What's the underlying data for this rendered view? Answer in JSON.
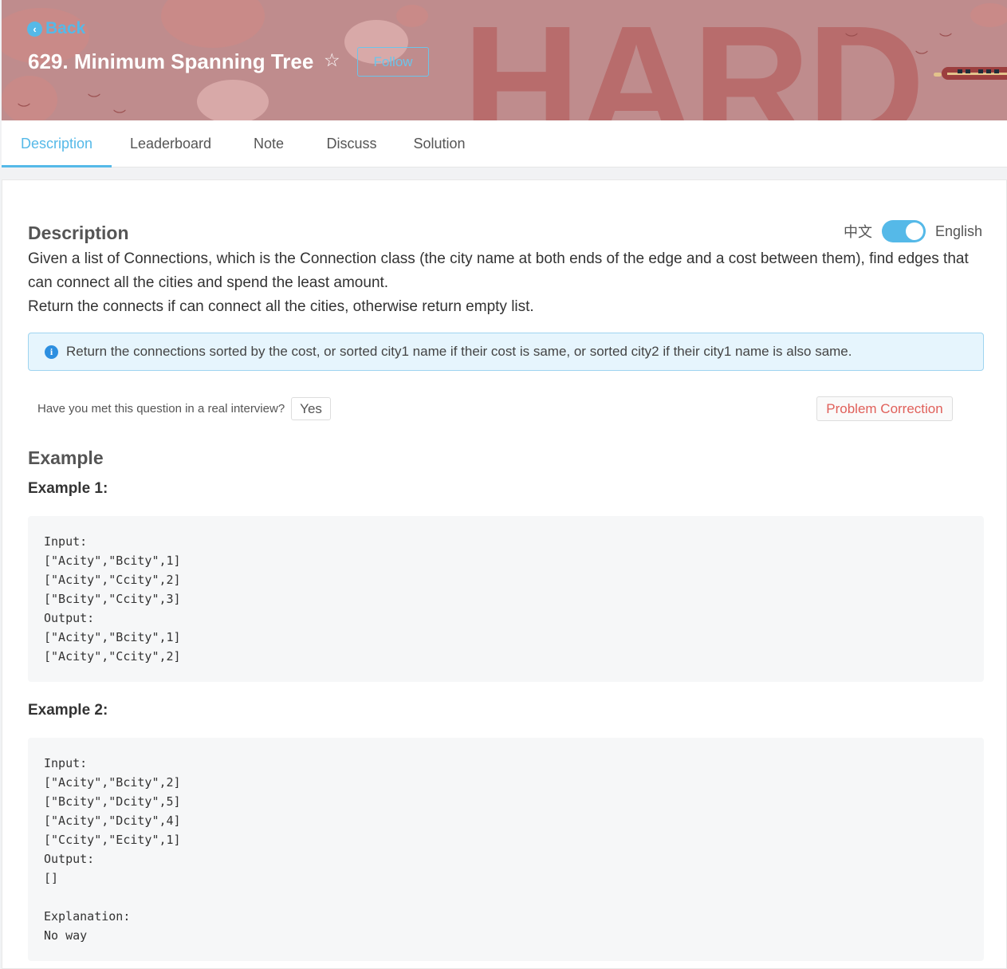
{
  "header": {
    "back_label": "Back",
    "title": "629. Minimum Spanning Tree",
    "follow_label": "Follow",
    "difficulty_word": "HARD"
  },
  "tabs": [
    {
      "label": "Description"
    },
    {
      "label": "Leaderboard"
    },
    {
      "label": "Note"
    },
    {
      "label": "Discuss"
    },
    {
      "label": "Solution"
    }
  ],
  "description": {
    "heading": "Description",
    "lang_zh": "中文",
    "lang_en": "English",
    "line1": "Given a list of Connections, which is the Connection class (the city name at both ends of the edge and a cost between them), find edges that can connect all the cities and spend the least amount.",
    "line2": "Return the connects if can connect all the cities, otherwise return empty list.",
    "info": "Return the connections sorted by the cost, or sorted city1 name if their cost is same, or sorted city2 if their city1 name is also same."
  },
  "interview": {
    "question": "Have you met this question in a real interview?",
    "yes_label": "Yes",
    "correction_label": "Problem Correction"
  },
  "examples": {
    "heading": "Example",
    "ex1_title": "Example 1:",
    "ex1_code": "Input:\n[\"Acity\",\"Bcity\",1]\n[\"Acity\",\"Ccity\",2]\n[\"Bcity\",\"Ccity\",3]\nOutput:\n[\"Acity\",\"Bcity\",1]\n[\"Acity\",\"Ccity\",2]",
    "ex2_title": "Example 2:",
    "ex2_code": "Input:\n[\"Acity\",\"Bcity\",2]\n[\"Bcity\",\"Dcity\",5]\n[\"Acity\",\"Dcity\",4]\n[\"Ccity\",\"Ecity\",1]\nOutput:\n[]\n\nExplanation:\nNo way"
  },
  "colors": {
    "accent": "#55b9e8",
    "banner": "#bf8c8d",
    "correction": "#e0605a"
  }
}
